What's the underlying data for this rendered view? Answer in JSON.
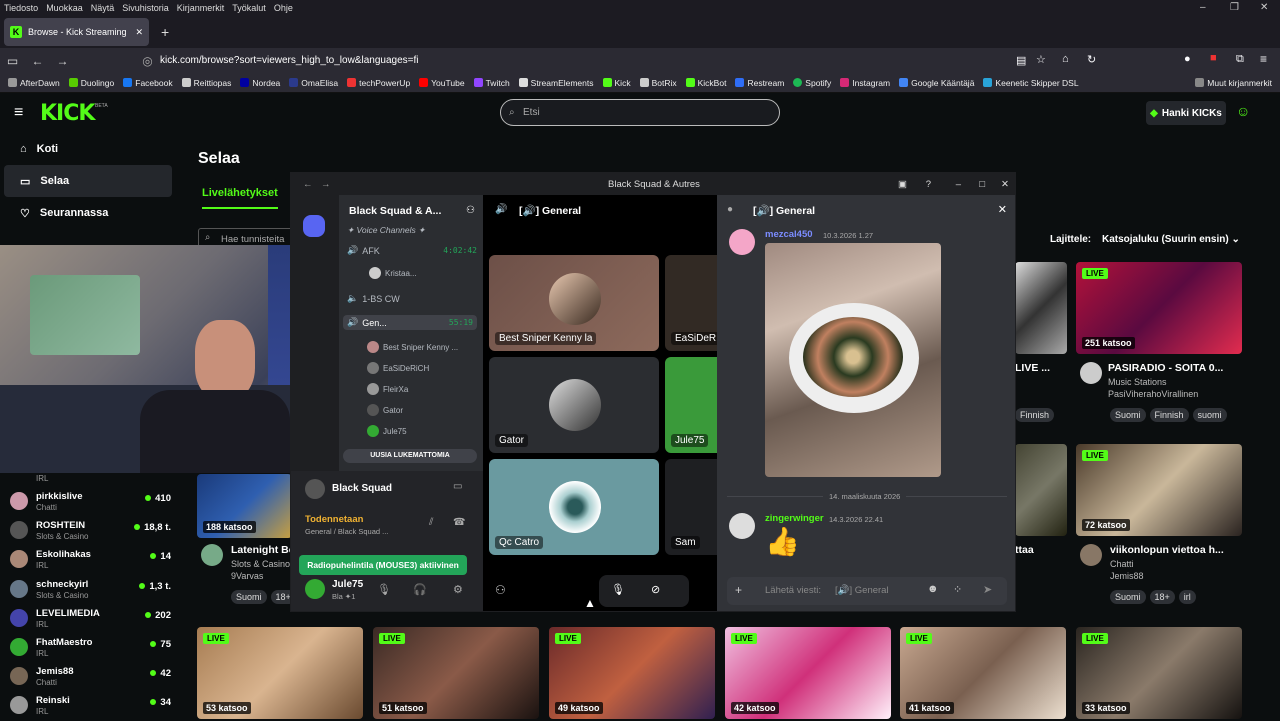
{
  "browser": {
    "menu": [
      "Tiedosto",
      "Muokkaa",
      "Näytä",
      "Sivuhistoria",
      "Kirjanmerkit",
      "Työkalut",
      "Ohje"
    ],
    "tab_title": "Browse - Kick Streaming",
    "url": "kick.com/browse?sort=viewers_high_to_low&languages=fi",
    "bookmarks": [
      "AfterDawn",
      "Duolingo",
      "Facebook",
      "Reittiopas",
      "Nordea",
      "OmaElisa",
      "techPowerUp",
      "YouTube",
      "Twitch",
      "StreamElements",
      "Kick",
      "BotRix",
      "KickBot",
      "Restream",
      "Spotify",
      "Instagram",
      "Google Kääntäjä",
      "Keenetic Skipper DSL"
    ],
    "other_bookmarks": "Muut kirjanmerkit"
  },
  "kick": {
    "logo": "KICK",
    "beta": "BETA",
    "search_placeholder": "Etsi",
    "get_kicks": "Hanki KICKs",
    "nav": {
      "home": "Koti",
      "browse": "Selaa",
      "following": "Seurannassa"
    },
    "page_title": "Selaa",
    "tab_live": "Livelähetykset",
    "tag_search_placeholder": "Hae tunnisteita",
    "sort_label": "Lajittele:",
    "sort_value": "Katsojaluku (Suurin ensin)",
    "sidebar_channels": [
      {
        "name": "",
        "category": "IRL",
        "viewers": ""
      },
      {
        "name": "pirkkislive",
        "category": "Chatti",
        "viewers": "410"
      },
      {
        "name": "ROSHTEIN",
        "category": "Slots & Casino",
        "viewers": "18,8 t."
      },
      {
        "name": "Eskolihakas",
        "category": "IRL",
        "viewers": "14"
      },
      {
        "name": "schneckyirl",
        "category": "Slots & Casino",
        "viewers": "1,3 t."
      },
      {
        "name": "LEVELIMEDIA",
        "category": "IRL",
        "viewers": "202"
      },
      {
        "name": "FhatMaestro",
        "category": "IRL",
        "viewers": "75"
      },
      {
        "name": "Jemis88",
        "category": "Chatti",
        "viewers": "42"
      },
      {
        "name": "Reinski",
        "category": "IRL",
        "viewers": "34"
      }
    ],
    "cards_top_right": [
      {
        "views": "251 katsoo",
        "live": "LIVE",
        "title": "PASIRADIO - SOITA 0...",
        "category": "Music Stations",
        "channel": "PasiViherahoVirallinen",
        "tags": [
          "Suomi",
          "Finnish",
          "suomi"
        ]
      },
      {
        "title": "LIVE ...",
        "tags": [
          "Finnish"
        ]
      }
    ],
    "cards_mid": [
      {
        "views": "188 katsoo",
        "title": "Latenight Be",
        "category": "Slots & Casino",
        "channel": "9Varvas",
        "tags": [
          "Suomi",
          "18+"
        ]
      },
      {
        "title": "ttaa"
      },
      {
        "views": "72 katsoo",
        "live": "LIVE",
        "title": "viikonlopun viettoa h...",
        "category": "Chatti",
        "channel": "Jemis88",
        "tags": [
          "Suomi",
          "18+",
          "irl"
        ]
      }
    ],
    "cards_bottom": [
      {
        "live": "LIVE",
        "views": "53 katsoo"
      },
      {
        "live": "LIVE",
        "views": "51 katsoo"
      },
      {
        "live": "LIVE",
        "views": "49 katsoo"
      },
      {
        "live": "LIVE",
        "views": "42 katsoo"
      },
      {
        "live": "LIVE",
        "views": "41 katsoo"
      },
      {
        "live": "LIVE",
        "views": "33 katsoo"
      }
    ]
  },
  "discord": {
    "window_title": "Black Squad & Autres",
    "server_name": "Black Squad & A...",
    "voice_channels_header": "✦ Voice Channels ✦",
    "afk_channel": "AFK",
    "afk_time": "4:02:42",
    "afk_user": "Kristaa...",
    "bs_channel": "1-BS CW",
    "general_channel": "Gen...",
    "general_time": "55:19",
    "members": [
      "Best Sniper Kenny ...",
      "EaSiDeRiCH",
      "FleirXa",
      "Gator",
      "Jule75"
    ],
    "unread_badge": "UUSIA LUKEMATTOMIA",
    "status_server": "Black Squad",
    "connected": "Todennetaan",
    "connected_sub": "General / Black Squad ...",
    "user_name": "Jule75",
    "user_status": "Bla ✦1",
    "toast": "Radiopuhelintila (MOUSE3) aktiivinen",
    "vc_header": "General",
    "tiles": [
      "Best Sniper Kenny la",
      "EaSiDeR",
      "Gator",
      "Jule75",
      "Qc Catro",
      "Sam"
    ],
    "chat": {
      "header": "General",
      "msg1_author": "mezcal450",
      "msg1_time": "10.3.2026 1.27",
      "date_divider": "14. maaliskuuta 2026",
      "msg2_author": "zingerwinger",
      "msg2_time": "14.3.2026 22.41",
      "msg2_emoji": "👍",
      "input_placeholder": "Lähetä viesti:",
      "input_channel": "General"
    }
  },
  "colors": {
    "kick_green": "#53fc18",
    "discord_bg": "#313338",
    "discord_green": "#23a559"
  }
}
